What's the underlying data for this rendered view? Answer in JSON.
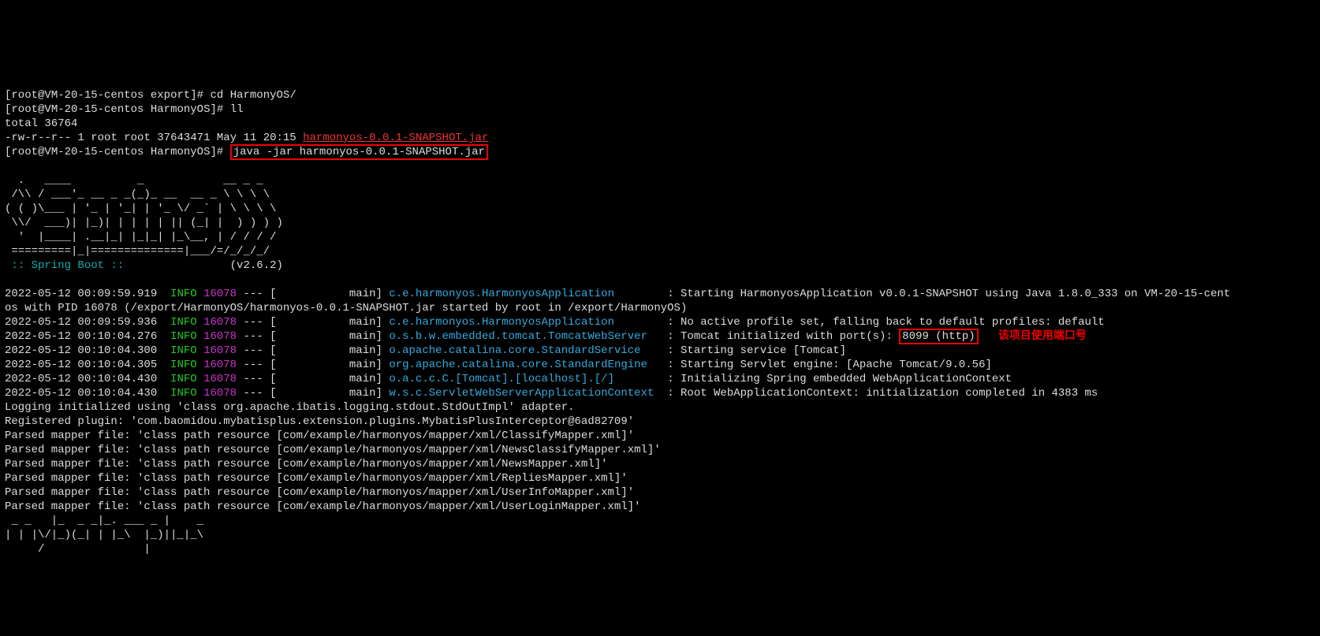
{
  "prompt": {
    "user": "root",
    "host": "VM-20-15-centos",
    "dir_export": "export",
    "dir_harmony": "HarmonyOS"
  },
  "cmd": {
    "cd": "cd HarmonyOS/",
    "ll": "ll",
    "java": "java -jar harmonyos-0.0.1-SNAPSHOT.jar"
  },
  "ls": {
    "total": "total 36764",
    "mode": "-rw-r--r--",
    "links": "1",
    "owner": "root",
    "group": "root",
    "size": "37643471",
    "date": "May 11 20:15",
    "file": "harmonyos-0.0.1-SNAPSHOT.jar"
  },
  "banner": {
    "l1": "  .   ____          _            __ _ _",
    "l2": " /\\\\ / ___'_ __ _ _(_)_ __  __ _ \\ \\ \\ \\",
    "l3": "( ( )\\___ | '_ | '_| | '_ \\/ _` | \\ \\ \\ \\",
    "l4": " \\\\/  ___)| |_)| | | | | || (_| |  ) ) ) )",
    "l5": "  '  |____| .__|_| |_|_| |_\\__, | / / / /",
    "l6": " =========|_|==============|___/=/_/_/_/",
    "boot": " :: Spring Boot ::",
    "version": "(v2.6.2)"
  },
  "log": [
    {
      "ts": "2022-05-12 00:09:59.919",
      "lvl": "INFO",
      "pid": "16078",
      "thr": "main",
      "cls": "c.e.harmonyos.HarmonyosApplication       ",
      "msg": "Starting HarmonyosApplication v0.0.1-SNAPSHOT using Java 1.8.0_333 on VM-20-15-cent"
    },
    {
      "ts": "2022-05-12 00:09:59.936",
      "lvl": "INFO",
      "pid": "16078",
      "thr": "main",
      "cls": "c.e.harmonyos.HarmonyosApplication       ",
      "msg": "No active profile set, falling back to default profiles: default"
    },
    {
      "ts": "2022-05-12 00:10:04.276",
      "lvl": "INFO",
      "pid": "16078",
      "thr": "main",
      "cls": "o.s.b.w.embedded.tomcat.TomcatWebServer  ",
      "msg": "Tomcat initialized with port(s):",
      "port": "8099 (http)"
    },
    {
      "ts": "2022-05-12 00:10:04.300",
      "lvl": "INFO",
      "pid": "16078",
      "thr": "main",
      "cls": "o.apache.catalina.core.StandardService   ",
      "msg": "Starting service [Tomcat]"
    },
    {
      "ts": "2022-05-12 00:10:04.305",
      "lvl": "INFO",
      "pid": "16078",
      "thr": "main",
      "cls": "org.apache.catalina.core.StandardEngine  ",
      "msg": "Starting Servlet engine: [Apache Tomcat/9.0.56]"
    },
    {
      "ts": "2022-05-12 00:10:04.430",
      "lvl": "INFO",
      "pid": "16078",
      "thr": "main",
      "cls": "o.a.c.c.C.[Tomcat].[localhost].[/]       ",
      "msg": "Initializing Spring embedded WebApplicationContext"
    },
    {
      "ts": "2022-05-12 00:10:04.430",
      "lvl": "INFO",
      "pid": "16078",
      "thr": "main",
      "cls": "w.s.c.ServletWebServerApplicationContext ",
      "msg": "Root WebApplicationContext: initialization completed in 4383 ms"
    }
  ],
  "cont": "os with PID 16078 (/export/HarmonyOS/harmonyos-0.0.1-SNAPSHOT.jar started by root in /export/HarmonyOS)",
  "plain": [
    "Logging initialized using 'class org.apache.ibatis.logging.stdout.StdOutImpl' adapter.",
    "Registered plugin: 'com.baomidou.mybatisplus.extension.plugins.MybatisPlusInterceptor@6ad82709'",
    "Parsed mapper file: 'class path resource [com/example/harmonyos/mapper/xml/ClassifyMapper.xml]'",
    "Parsed mapper file: 'class path resource [com/example/harmonyos/mapper/xml/NewsClassifyMapper.xml]'",
    "Parsed mapper file: 'class path resource [com/example/harmonyos/mapper/xml/NewsMapper.xml]'",
    "Parsed mapper file: 'class path resource [com/example/harmonyos/mapper/xml/RepliesMapper.xml]'",
    "Parsed mapper file: 'class path resource [com/example/harmonyos/mapper/xml/UserInfoMapper.xml]'",
    "Parsed mapper file: 'class path resource [com/example/harmonyos/mapper/xml/UserLoginMapper.xml]'"
  ],
  "mybatis": {
    "l1": " _ _   |_  _ _|_. ___ _ |    _ ",
    "l2": "| | |\\/|_)(_| | |_\\  |_)||_|_\\ ",
    "l3": "     /               |         "
  },
  "annotation": "该项目使用端口号"
}
